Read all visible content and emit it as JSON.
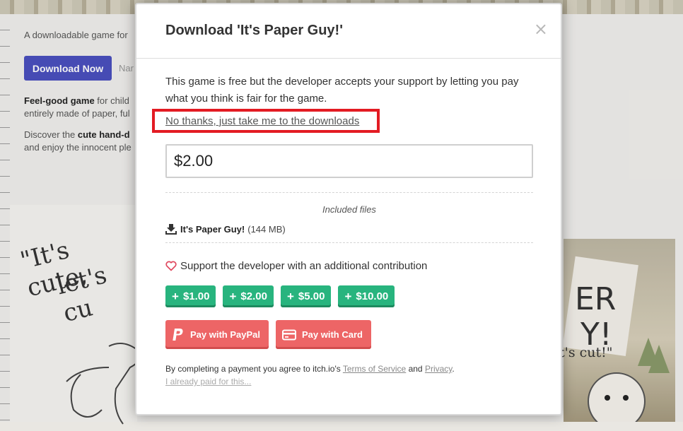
{
  "background": {
    "tagline": "A downloadable game for",
    "download_button": "Download Now",
    "name_your_price": "Nar",
    "desc1_bold": "Feel-good game",
    "desc1_rest": " for child",
    "desc1_line2": "entirely made of paper, ful",
    "desc2_start": "Discover the ",
    "desc2_bold": "cute hand-d",
    "desc2_line2": "and enjoy the innocent ple",
    "art_text_1": "\"It's cute,",
    "art_text_2": "let's cu",
    "art_right_text": "t's cut!\""
  },
  "modal": {
    "title": "Download 'It's Paper Guy!'",
    "close_symbol": "×",
    "intro": "This game is free but the developer accepts your support by letting you pay what you think is fair for the game.",
    "skip_link": "No thanks, just take me to the downloads",
    "amount_value": "$2.00",
    "files": {
      "title": "Included files",
      "items": [
        {
          "name": "It's Paper Guy!",
          "size": "(144 MB)"
        }
      ]
    },
    "support_label": "Support the developer with an additional contribution",
    "tips": [
      "$1.00",
      "$2.00",
      "$5.00",
      "$10.00"
    ],
    "paypal_label": "Pay with PayPal",
    "card_label": "Pay with Card",
    "legal": {
      "prefix": "By completing a payment you agree to itch.io's ",
      "terms": "Terms of Service",
      "and": " and ",
      "privacy": "Privacy",
      "suffix": "."
    },
    "already_paid": "I already paid for this..."
  },
  "colors": {
    "tip_green": "#28b47e",
    "pay_red": "#ed6566",
    "highlight_red": "#e31b23",
    "bg_download_blue": "#4a4fbf"
  }
}
